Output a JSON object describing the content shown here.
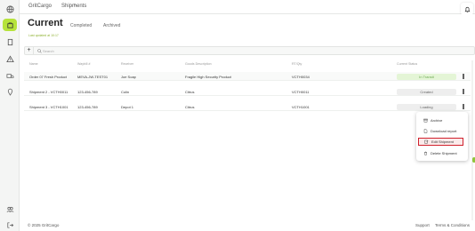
{
  "breadcrumb": {
    "home": "GritCargo",
    "separator": "›",
    "current": "Shipments"
  },
  "page": {
    "title": "Current",
    "updated": "Last updated at 10:17"
  },
  "tabs": [
    {
      "label": "Completed"
    },
    {
      "label": "Archived"
    }
  ],
  "toolbar": {
    "add_label": "+",
    "search_placeholder": "Search"
  },
  "table": {
    "columns": [
      "Name",
      "Waybill #",
      "Receiver",
      "Goods Description",
      "RT/Qty",
      "Current Status"
    ],
    "rows": [
      {
        "name": "Order 07 Fresh Product",
        "waybill": "MEVA-JW-TEST01",
        "receiver": "Joe Soap",
        "goods": "Fragile High Security Product",
        "rtqty": "VCTH0034",
        "status": "In Transit"
      },
      {
        "name": "Shipment 2 - VCTH0011",
        "waybill": "123-456-789",
        "receiver": "Colin",
        "goods": "Citrus",
        "rtqty": "VCTH0011",
        "status": "Created"
      },
      {
        "name": "Shipment 3 - VCTH1001",
        "waybill": "123-456-789",
        "receiver": "Depot 1",
        "goods": "Citrus",
        "rtqty": "VCTH1001",
        "status": "Loading"
      }
    ]
  },
  "context_menu": {
    "items": [
      {
        "label": "Archive",
        "icon": "archive-icon"
      },
      {
        "label": "Download report",
        "icon": "download-icon"
      },
      {
        "label": "Edit Shipment",
        "icon": "edit-icon"
      },
      {
        "label": "Delete Shipment",
        "icon": "trash-icon"
      }
    ]
  },
  "footer": {
    "copyright": "© 2025 GritCargo",
    "support": "Support",
    "terms": "Terms & Conditions"
  },
  "colors": {
    "accent": "#b6e33b",
    "status_in_transit_bg": "#e4f5d6",
    "status_in_transit_text": "#6aa84f",
    "status_neutral_bg": "#eeeeee",
    "status_neutral_text": "#666666",
    "highlight_border": "#d0202c"
  }
}
